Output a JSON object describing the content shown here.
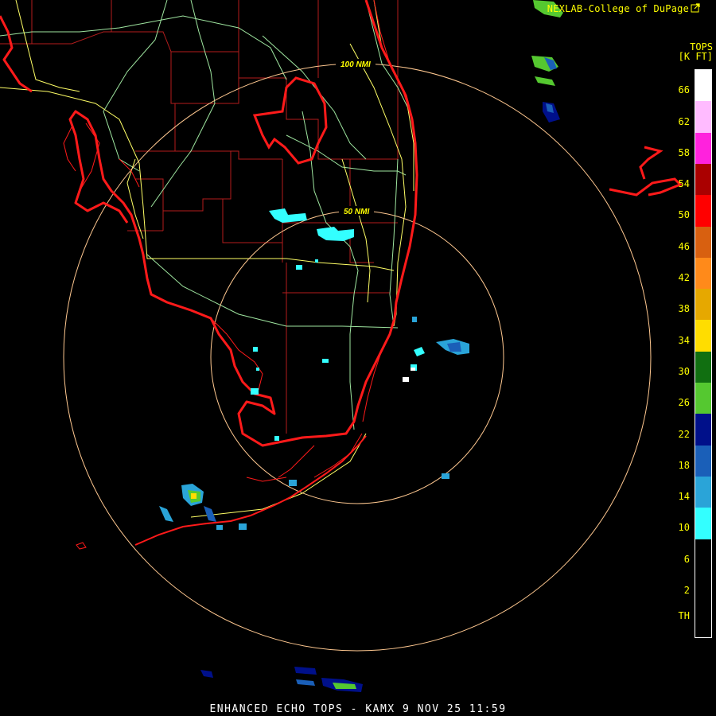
{
  "header": {
    "credit": "NEXLAB-College of DuPage",
    "credit_icon": "external-link-icon"
  },
  "legend": {
    "title_line1": "TOPS",
    "title_line2": "[K FT]",
    "colors": [
      "#000000",
      "#33ffff",
      "#2aa4d8",
      "#1a5fb8",
      "#00108a",
      "#55c830",
      "#116f11",
      "#ffdd00",
      "#e6a800",
      "#ff8a1a",
      "#d86010",
      "#ff0000",
      "#aa0000",
      "#ff22dd",
      "#ffbbff",
      "#ffffff"
    ],
    "labels": [
      "TH",
      "2",
      "6",
      "10",
      "14",
      "18",
      "22",
      "26",
      "30",
      "34",
      "38",
      "42",
      "46",
      "50",
      "54",
      "58",
      "62",
      "66"
    ]
  },
  "map": {
    "inner_ring_label": "50 NMI",
    "outer_ring_label": "100 NMI",
    "coast_color": "#ff1a1a",
    "county_color": "#b31d1d",
    "road_color": "#9fe6a0",
    "highway_color": "#ffff66",
    "ring_color": "#ffc890"
  },
  "footer": {
    "product": "ENHANCED ECHO TOPS",
    "separator": "-",
    "station": "KAMX",
    "date": "9 NOV 25",
    "time": "11:59"
  }
}
